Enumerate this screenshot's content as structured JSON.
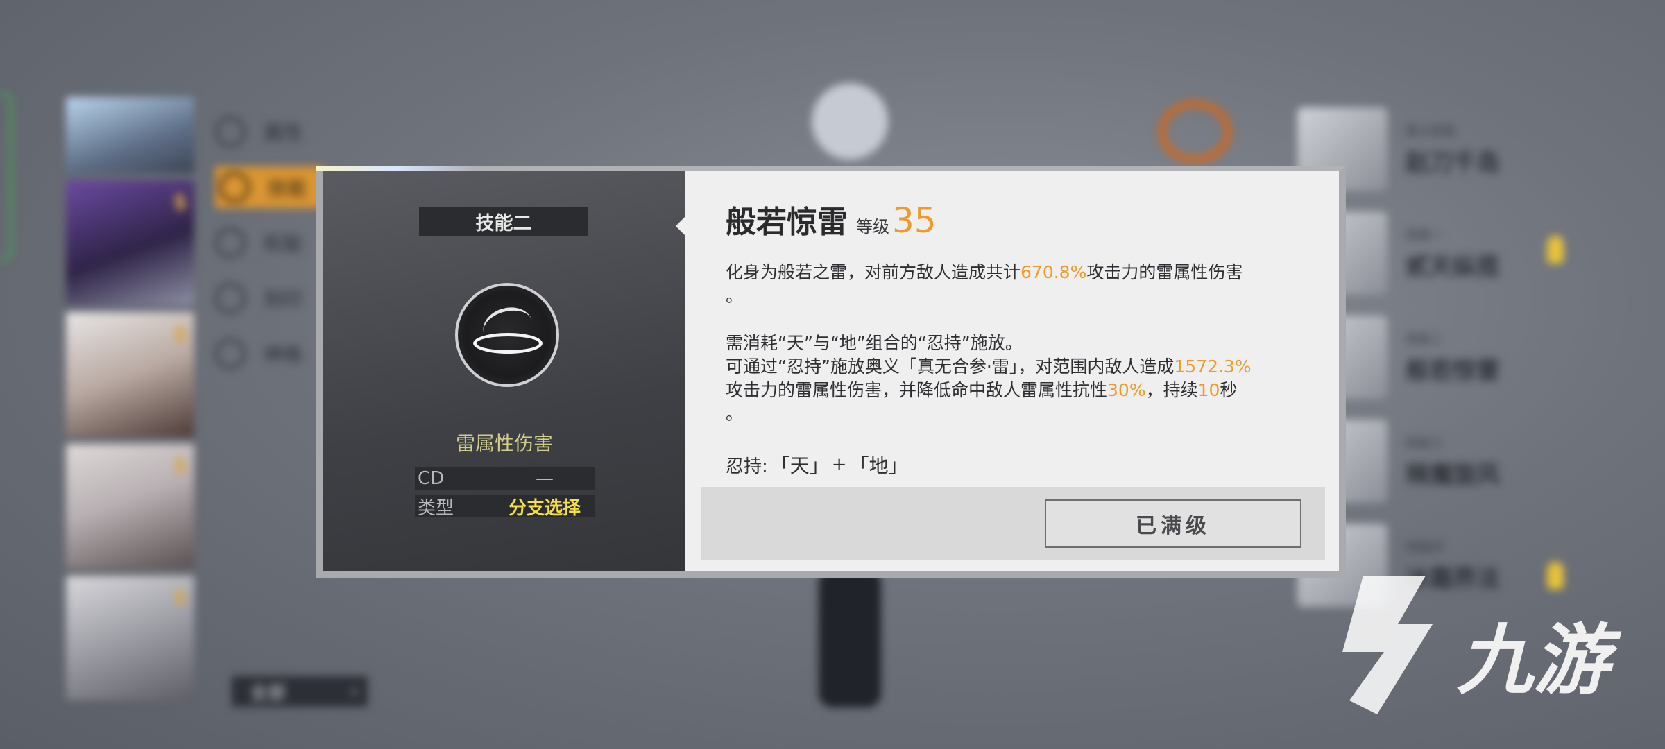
{
  "background": {
    "left_menu": [
      {
        "label": "属性",
        "icon": "attribute-icon"
      },
      {
        "label": "技能",
        "icon": "skill-icon"
      },
      {
        "label": "权能",
        "icon": "power-icon"
      },
      {
        "label": "刻印",
        "icon": "gear-icon"
      },
      {
        "label": "神格",
        "icon": "code-icon"
      }
    ],
    "all_button": "全部",
    "right_list": [
      {
        "sub": "奥义技能",
        "name": "赵刀千岛"
      },
      {
        "sub": "技能一",
        "name": "贰天纵揽"
      },
      {
        "sub": "技能二",
        "name": "般若惊雷"
      },
      {
        "sub": "技能三",
        "name": "辣魔旋风"
      },
      {
        "sub": "技能四",
        "name": "冰霜界法"
      }
    ]
  },
  "modal": {
    "skill_tag": "技能二",
    "element": "雷属性伤害",
    "stats": [
      {
        "key": "CD",
        "value": "—"
      },
      {
        "key": "类型",
        "value": "分支选择"
      }
    ],
    "name": "般若惊雷",
    "level_label": "等级",
    "level": "35",
    "desc": {
      "l1a": "化身为般若之雷，对前方敌人造成共计",
      "l1h": "670.8%",
      "l1b": "攻击力的雷属性伤害",
      "l1end": "。",
      "l2": "需消耗“天”与“地”组合的“忍持”施放。",
      "l3a": "可通过“忍持”施放奥义「真无合参·雷」，对范围内敌人造成",
      "l3h": "1572.3%",
      "l4a": "攻击力的雷属性伤害，并降低命中敌人雷属性抗性",
      "l4h1": "30%",
      "l4b": "，持续",
      "l4h2": "10",
      "l4c": "秒",
      "l4end": "。"
    },
    "combo": {
      "label": "忍持:",
      "a": "「天」",
      "plus": "+",
      "b": "「地」"
    },
    "max_button": "已满级",
    "accent": "#f19a28"
  },
  "watermark": {
    "text": "九游"
  }
}
